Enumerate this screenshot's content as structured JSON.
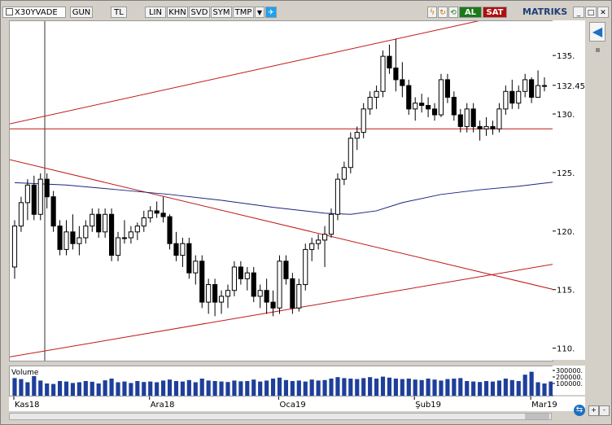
{
  "toolbar": {
    "symbol": "X30YVADE",
    "buttons": [
      "GUN",
      "TL",
      "LIN",
      "KHN",
      "SVD",
      "SYM",
      "TMP"
    ],
    "al_label": "AL",
    "sat_label": "SAT",
    "brand": "MATRIKS",
    "colors": {
      "al": "#1a7a1a",
      "sat": "#b01010",
      "brand_text": "#1e3f7a",
      "twitter": "#1da1f2"
    }
  },
  "chart_data": {
    "type": "candlestick",
    "price_ticks": [
      "135.",
      "132.45",
      "130.",
      "125.",
      "120.",
      "115.",
      "110."
    ],
    "current_price": "132.45",
    "date_labels": [
      "Kas18",
      "Ara18",
      "Oca19",
      "Şub19",
      "Mar19"
    ],
    "volume_label": "Volume",
    "volume_ticks": [
      "300000.",
      "200000.",
      "100000."
    ],
    "ylim": [
      109,
      138
    ],
    "candles": [
      [
        117,
        121,
        116,
        120.5
      ],
      [
        120.5,
        123,
        120,
        122.5
      ],
      [
        122.5,
        124.5,
        121,
        124
      ],
      [
        124,
        124.8,
        121,
        121.5
      ],
      [
        121.5,
        125,
        121,
        124.5
      ],
      [
        124.5,
        125,
        122,
        123
      ],
      [
        123,
        123.5,
        120,
        120.5
      ],
      [
        120.5,
        121,
        118,
        118.5
      ],
      [
        118.5,
        121,
        118,
        120
      ],
      [
        120,
        121.5,
        118.5,
        119
      ],
      [
        119,
        120.5,
        118,
        119.5
      ],
      [
        119.5,
        121,
        119,
        120.5
      ],
      [
        120.5,
        122,
        120,
        121.5
      ],
      [
        121.5,
        122,
        119.5,
        120
      ],
      [
        120,
        122,
        119.5,
        121.5
      ],
      [
        121.5,
        122,
        117.5,
        118
      ],
      [
        118,
        120,
        117.5,
        119.5
      ],
      [
        119.5,
        121,
        119,
        119.5
      ],
      [
        119.5,
        120.5,
        119,
        120
      ],
      [
        120,
        120.8,
        119.3,
        120.5
      ],
      [
        120.5,
        121.8,
        120,
        121.2
      ],
      [
        121.2,
        122.2,
        120.8,
        121.8
      ],
      [
        121.8,
        122.6,
        121.2,
        121.6
      ],
      [
        121.6,
        123,
        120.8,
        121.3
      ],
      [
        121.3,
        121.5,
        118.5,
        119
      ],
      [
        119,
        120,
        117.5,
        118
      ],
      [
        118,
        119.5,
        117,
        119
      ],
      [
        119,
        119.5,
        116,
        116.5
      ],
      [
        116.5,
        118,
        115.5,
        117.5
      ],
      [
        117.5,
        118,
        113.5,
        114
      ],
      [
        114,
        116,
        113,
        115.5
      ],
      [
        115.5,
        116,
        112.8,
        114
      ],
      [
        114,
        115,
        113,
        114.5
      ],
      [
        114.5,
        115.5,
        113.5,
        115
      ],
      [
        115,
        117.5,
        114.5,
        117
      ],
      [
        117,
        117.5,
        115.5,
        116
      ],
      [
        116,
        117,
        115,
        116.5
      ],
      [
        116.5,
        117,
        114,
        114.5
      ],
      [
        114.5,
        115.5,
        113.5,
        115
      ],
      [
        115,
        116,
        113,
        114
      ],
      [
        114,
        115,
        112.8,
        113.5
      ],
      [
        113.5,
        118,
        113,
        117.5
      ],
      [
        117.5,
        118,
        115.5,
        116
      ],
      [
        116,
        116.5,
        113,
        113.5
      ],
      [
        113.5,
        116,
        113.2,
        115.5
      ],
      [
        115.5,
        119,
        115,
        118.5
      ],
      [
        118.5,
        119.5,
        117.5,
        119
      ],
      [
        119,
        119.8,
        118.5,
        119.3
      ],
      [
        119.3,
        120.5,
        117,
        119.8
      ],
      [
        119.8,
        122,
        119.5,
        121.5
      ],
      [
        121.5,
        125,
        121,
        124.5
      ],
      [
        124.5,
        126,
        124,
        125.5
      ],
      [
        125.5,
        128.5,
        125,
        128
      ],
      [
        128,
        129,
        127,
        128.5
      ],
      [
        128.5,
        131,
        128,
        130.5
      ],
      [
        130.5,
        132,
        130,
        131.5
      ],
      [
        131.5,
        132.5,
        130.5,
        132
      ],
      [
        132,
        135.5,
        131.5,
        135
      ],
      [
        135,
        136,
        133.5,
        134
      ],
      [
        134,
        136.5,
        132,
        133
      ],
      [
        133,
        134.5,
        131.5,
        132.5
      ],
      [
        132.5,
        133,
        130,
        130.5
      ],
      [
        130.5,
        131.5,
        129.5,
        131
      ],
      [
        131,
        131.8,
        130.2,
        130.8
      ],
      [
        130.8,
        131.5,
        129.8,
        130.5
      ],
      [
        130.5,
        131,
        129.5,
        130
      ],
      [
        130,
        133.5,
        129.8,
        133
      ],
      [
        133,
        133.5,
        131,
        131.5
      ],
      [
        131.5,
        132,
        129.5,
        130
      ],
      [
        130,
        130.5,
        128.5,
        129
      ],
      [
        129,
        131,
        128.5,
        130.5
      ],
      [
        130.5,
        131,
        128.5,
        129
      ],
      [
        129,
        129.5,
        127.8,
        128.8
      ],
      [
        128.8,
        129.8,
        128.2,
        129
      ],
      [
        129,
        129.5,
        128.3,
        128.8
      ],
      [
        128.8,
        131,
        128.5,
        130.5
      ],
      [
        130.5,
        132.5,
        130,
        132
      ],
      [
        132,
        133,
        130.5,
        131
      ],
      [
        131,
        132.5,
        130.5,
        132
      ],
      [
        132,
        133.5,
        131.5,
        133
      ],
      [
        133,
        133.2,
        131,
        131.5
      ],
      [
        131.5,
        133.8,
        131.5,
        132.5
      ],
      [
        132.5,
        133.2,
        132,
        132.45
      ]
    ],
    "ma_points": [
      [
        0,
        124.2
      ],
      [
        8,
        124.0
      ],
      [
        16,
        123.6
      ],
      [
        24,
        123.2
      ],
      [
        32,
        122.7
      ],
      [
        40,
        122.1
      ],
      [
        48,
        121.6
      ],
      [
        52,
        121.5
      ],
      [
        56,
        121.8
      ],
      [
        60,
        122.5
      ],
      [
        66,
        123.2
      ],
      [
        72,
        123.6
      ],
      [
        78,
        123.9
      ],
      [
        84,
        124.3
      ]
    ],
    "volumes": [
      0.72,
      0.68,
      0.55,
      0.8,
      0.62,
      0.5,
      0.48,
      0.6,
      0.58,
      0.52,
      0.55,
      0.6,
      0.57,
      0.5,
      0.63,
      0.7,
      0.55,
      0.58,
      0.52,
      0.6,
      0.56,
      0.58,
      0.55,
      0.62,
      0.66,
      0.6,
      0.58,
      0.64,
      0.55,
      0.7,
      0.62,
      0.6,
      0.58,
      0.56,
      0.62,
      0.59,
      0.6,
      0.66,
      0.58,
      0.62,
      0.7,
      0.74,
      0.64,
      0.6,
      0.62,
      0.58,
      0.66,
      0.62,
      0.64,
      0.7,
      0.76,
      0.72,
      0.7,
      0.68,
      0.72,
      0.76,
      0.7,
      0.78,
      0.74,
      0.7,
      0.68,
      0.7,
      0.66,
      0.64,
      0.7,
      0.66,
      0.62,
      0.68,
      0.7,
      0.72,
      0.6,
      0.58,
      0.56,
      0.6,
      0.58,
      0.62,
      0.7,
      0.64,
      0.6,
      0.86,
      0.98,
      0.55,
      0.5,
      0.58
    ]
  }
}
